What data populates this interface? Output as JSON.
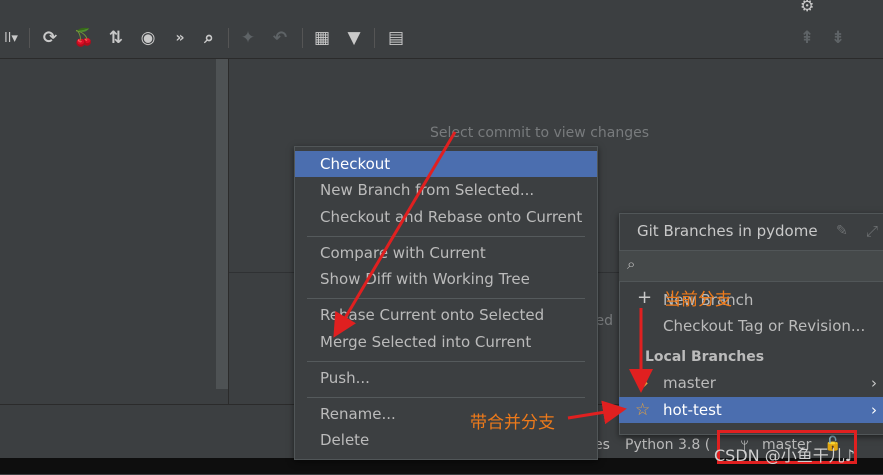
{
  "toolbar": {
    "left_label": "ll▾",
    "more": "»"
  },
  "log": {
    "empty_hint": "Select commit to view changes",
    "partial_hint": "ted"
  },
  "context_menu": {
    "items": [
      {
        "label": "Checkout",
        "selected": true
      },
      {
        "label": "New Branch from Selected..."
      },
      {
        "label": "Checkout and Rebase onto Current"
      },
      {
        "label": "Compare with Current"
      },
      {
        "label": "Show Diff with Working Tree"
      },
      {
        "label": "Rebase Current onto Selected"
      },
      {
        "label": "Merge Selected into Current"
      },
      {
        "label": "Push..."
      },
      {
        "label": "Rename..."
      },
      {
        "label": "Delete"
      }
    ]
  },
  "branches_popup": {
    "title": "Git Branches in pydome",
    "search_placeholder": "",
    "new_branch": "New Branch",
    "checkout_tag": "Checkout Tag or Revision...",
    "section": "Local Branches",
    "branches": [
      {
        "name": "master",
        "current": true
      },
      {
        "name": "hot-test",
        "favorite": true,
        "selected": true
      }
    ]
  },
  "status_bar": {
    "left_fragment": "es",
    "interpreter": "Python 3.8 (",
    "branch": "master"
  },
  "annotations": {
    "current_branch": "当前分支",
    "merge_branch": "带合并分支"
  },
  "watermark": "CSDN @小鱼干儿♪",
  "colors": {
    "selection": "#4b6eaf",
    "annotation": "#ee7a1a",
    "highlight_box": "#e02020"
  }
}
